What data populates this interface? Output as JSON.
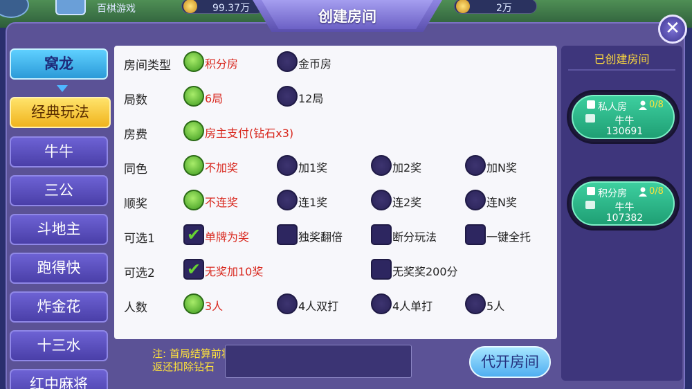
{
  "topbar": {
    "brand": "百棋游戏",
    "coins": "99.37万",
    "diamonds": "2万"
  },
  "dialog": {
    "title": "创建房间",
    "close_icon": "close-icon"
  },
  "nav": {
    "top_label": "窝龙",
    "items": [
      {
        "label": "经典玩法",
        "selected": true
      },
      {
        "label": "牛牛"
      },
      {
        "label": "三公"
      },
      {
        "label": "斗地主"
      },
      {
        "label": "跑得快"
      },
      {
        "label": "炸金花"
      },
      {
        "label": "十三水"
      },
      {
        "label": "红中麻将"
      }
    ]
  },
  "settings": [
    {
      "label": "房间类型",
      "options": [
        {
          "text": "积分房",
          "on": true
        },
        {
          "text": "金币房",
          "on": false
        }
      ]
    },
    {
      "label": "局数",
      "options": [
        {
          "text": "6局",
          "on": true
        },
        {
          "text": "12局",
          "on": false
        }
      ]
    },
    {
      "label": "房费",
      "options": [
        {
          "text": "房主支付(钻石x3)",
          "on": true
        }
      ]
    },
    {
      "label": "同色",
      "options": [
        {
          "text": "不加奖",
          "on": true
        },
        {
          "text": "加1奖",
          "on": false
        },
        {
          "text": "加2奖",
          "on": false
        },
        {
          "text": "加N奖",
          "on": false
        }
      ]
    },
    {
      "label": "顺奖",
      "options": [
        {
          "text": "不连奖",
          "on": true
        },
        {
          "text": "连1奖",
          "on": false
        },
        {
          "text": "连2奖",
          "on": false
        },
        {
          "text": "连N奖",
          "on": false
        }
      ]
    },
    {
      "label": "可选1",
      "type": "check",
      "options": [
        {
          "text": "单牌为奖",
          "on": true
        },
        {
          "text": "独奖翻倍",
          "on": false
        },
        {
          "text": "断分玩法",
          "on": false
        },
        {
          "text": "一键全托",
          "on": false
        }
      ]
    },
    {
      "label": "可选2",
      "type": "check",
      "options": [
        {
          "text": "无奖加10奖",
          "on": true
        },
        {
          "text": "",
          "on": false,
          "blank": true
        },
        {
          "text": "无奖奖200分",
          "on": false
        }
      ]
    },
    {
      "label": "人数",
      "options": [
        {
          "text": "3人",
          "on": true
        },
        {
          "text": "4人双打",
          "on": false
        },
        {
          "text": "4人单打",
          "on": false
        },
        {
          "text": "5人",
          "on": false
        }
      ]
    }
  ],
  "footer": {
    "note_line1": "注: 首局结算前将",
    "note_line2": "返还扣除钻石",
    "open_button": "代开房间"
  },
  "right_panel": {
    "title": "已创建房间",
    "rooms": [
      {
        "name": "私人房",
        "count": "0/8",
        "game": "牛牛",
        "id": "130691"
      },
      {
        "name": "积分房",
        "count": "0/8",
        "game": "牛牛",
        "id": "107382"
      }
    ]
  },
  "colors": {
    "selected_text": "#d8261c",
    "accent_yellow": "#ffe23a",
    "radio_on": "#3d9a1f"
  }
}
